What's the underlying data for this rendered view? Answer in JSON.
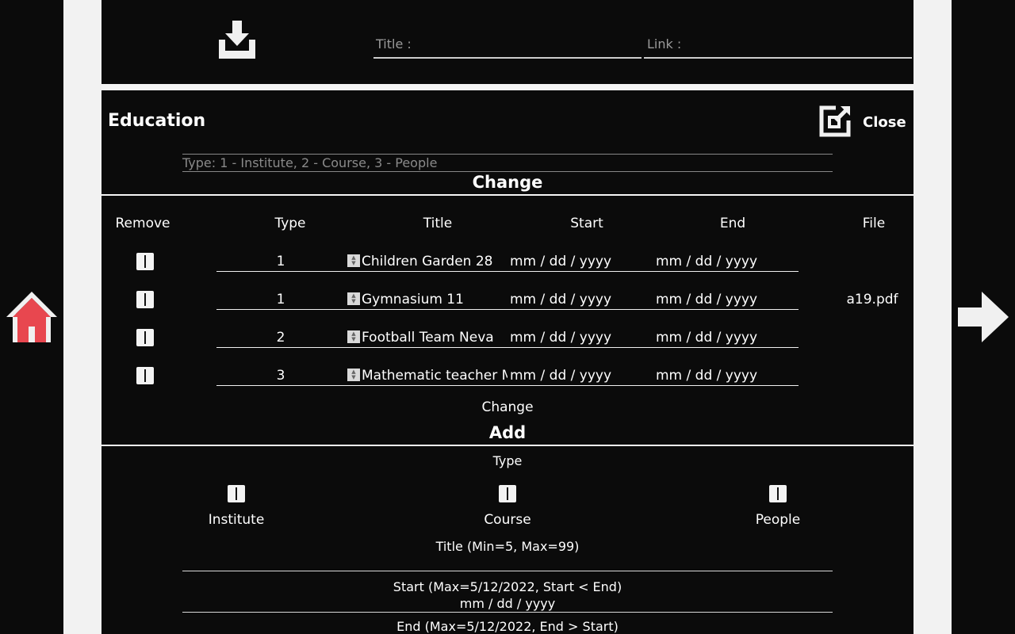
{
  "top": {
    "title_placeholder": "Title :",
    "link_placeholder": "Link :",
    "download_icon": "download-icon"
  },
  "education": {
    "heading": "Education",
    "close_label": "Close",
    "type_placeholder": "Type: 1 - Institute, 2 - Course, 3 - People",
    "change_section_title": "Change",
    "columns": [
      "Remove",
      "Type",
      "Title",
      "Start",
      "End",
      "File"
    ],
    "rows": [
      {
        "type": "1",
        "title": "Children Garden 28",
        "start": "mm / dd / yyyy",
        "end": "mm / dd / yyyy",
        "file": ""
      },
      {
        "type": "1",
        "title": "Gymnasium 11",
        "start": "mm / dd / yyyy",
        "end": "mm / dd / yyyy",
        "file": "a19.pdf"
      },
      {
        "type": "2",
        "title": "Football Team Neva",
        "start": "mm / dd / yyyy",
        "end": "mm / dd / yyyy",
        "file": ""
      },
      {
        "type": "3",
        "title": "Mathematic teacher M",
        "start": "mm / dd / yyyy",
        "end": "mm / dd / yyyy",
        "file": ""
      }
    ],
    "change_button": "Change",
    "add_section_title": "Add",
    "add": {
      "type_label": "Type",
      "type_options": [
        "Institute",
        "Course",
        "People"
      ],
      "title_label": "Title (Min=5, Max=99)",
      "start_label": "Start (Max=5/12/2022, Start < End)",
      "start_value": "mm / dd / yyyy",
      "end_label": "End (Max=5/12/2022, End > Start)"
    }
  },
  "nav": {
    "home_icon": "home-icon",
    "next_icon": "arrow-right-icon"
  },
  "colors": {
    "background": "#0b0b0b",
    "gutter": "#f2f2f2",
    "home_roof": "#e8474f"
  }
}
